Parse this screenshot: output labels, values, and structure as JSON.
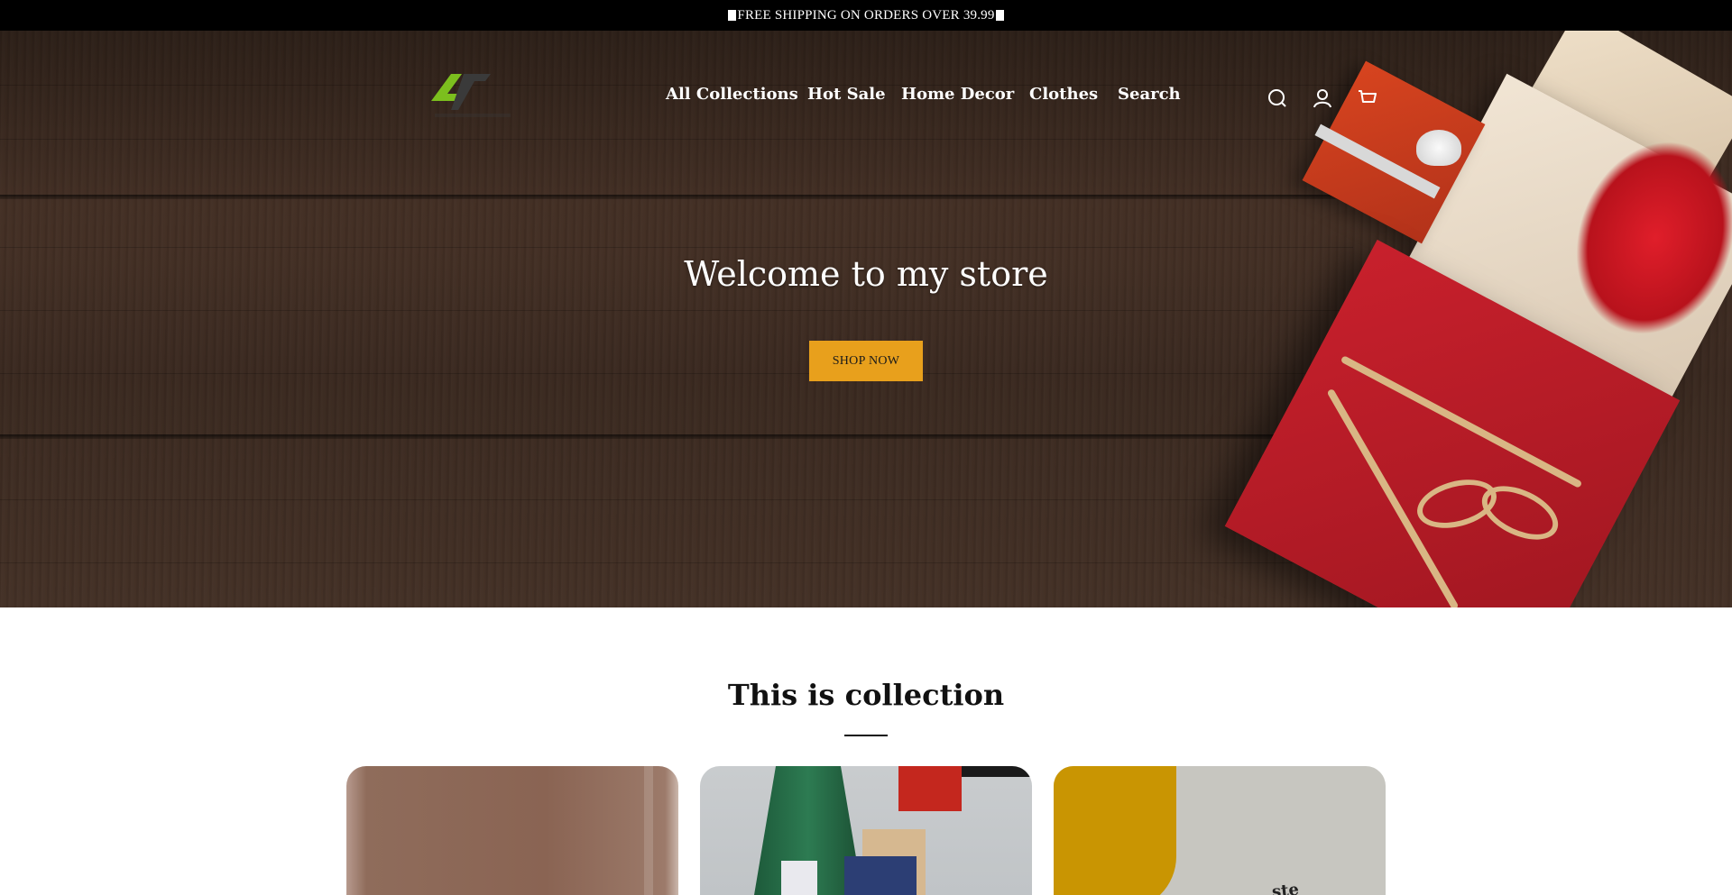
{
  "announcement": {
    "text": "FREE SHIPPING ON ORDERS OVER 39.99"
  },
  "header": {
    "nav": [
      {
        "label": "All Collections"
      },
      {
        "label": "Hot Sale"
      },
      {
        "label": "Home Decor"
      },
      {
        "label": "Clothes"
      },
      {
        "label": "Search"
      }
    ],
    "icons": [
      "search-icon",
      "account-icon",
      "cart-icon"
    ],
    "logo_colors": {
      "green": "#7cbf1e",
      "dark": "#3a3a3a"
    }
  },
  "hero": {
    "title": "Welcome to my store",
    "button_label": "SHOP NOW",
    "button_color": "#e8a01c"
  },
  "collection": {
    "title": "This is collection",
    "cards": [
      {
        "name": "collection-card-1"
      },
      {
        "name": "collection-card-2"
      },
      {
        "name": "collection-card-3",
        "partial_text": "ste"
      }
    ]
  }
}
